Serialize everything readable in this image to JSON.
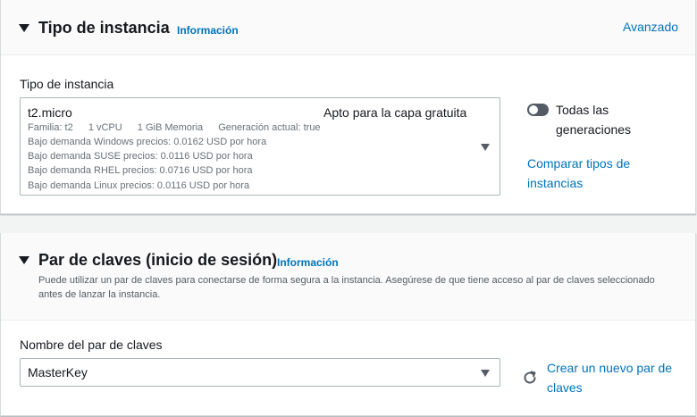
{
  "instance_type_panel": {
    "title": "Tipo de instancia",
    "info_link": "Información",
    "advanced_link": "Avanzado",
    "field_label": "Tipo de instancia",
    "selected": {
      "name": "t2.micro",
      "free_tier": "Apto para la capa gratuita",
      "family": "Familia: t2",
      "vcpu": "1 vCPU",
      "memory": "1 GiB Memoria",
      "generation": "Generación actual: true",
      "prices": [
        "Bajo demanda Windows precios: 0.0162 USD por hora",
        "Bajo demanda SUSE precios: 0.0116 USD por hora",
        "Bajo demanda RHEL precios: 0.0716 USD por hora",
        "Bajo demanda Linux precios: 0.0116 USD por hora"
      ]
    },
    "toggle_label": "Todas las generaciones",
    "toggle_on": false,
    "compare_link": "Comparar tipos de instancias"
  },
  "key_pair_panel": {
    "title": "Par de claves (inicio de sesión)",
    "info_link": "Información",
    "description": "Puede utilizar un par de claves para conectarse de forma segura a la instancia. Asegúrese de que tiene acceso al par de claves seleccionado antes de lanzar la instancia.",
    "field_label": "Nombre del par de claves",
    "selected": "MasterKey",
    "create_link": "Crear un nuevo par de claves"
  },
  "colors": {
    "link": "#0073bb",
    "text": "#16191f",
    "secondary_text": "#687078",
    "toggle_off": "#545b64"
  }
}
